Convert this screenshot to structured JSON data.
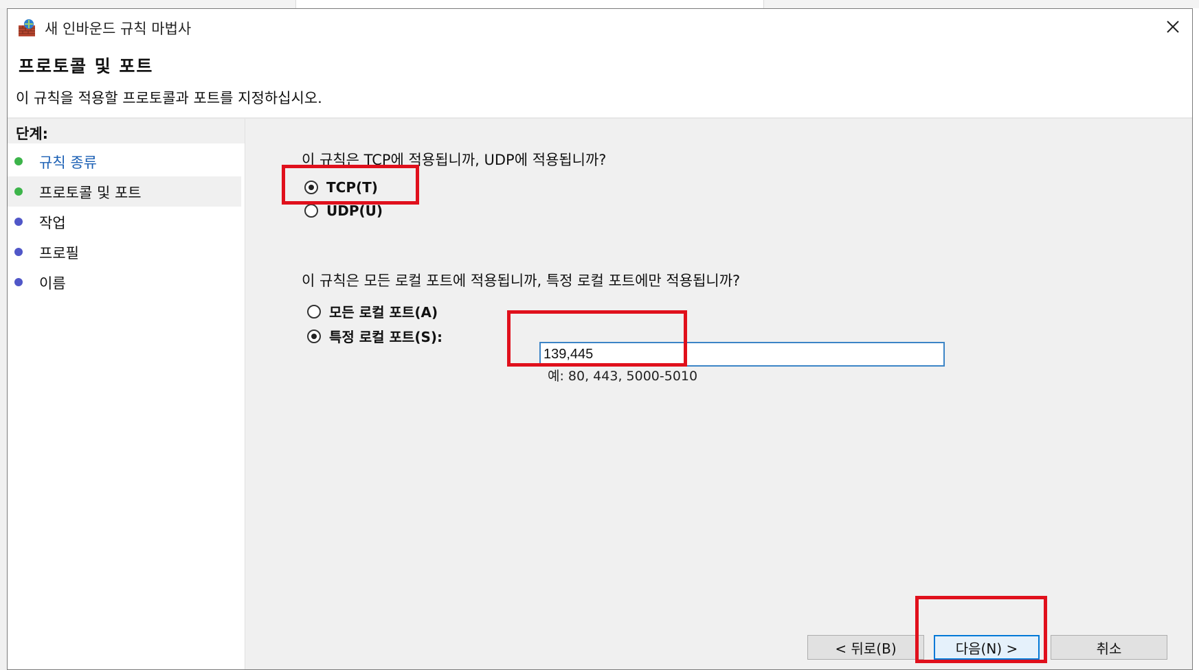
{
  "window": {
    "title": "새 인바운드 규칙 마법사",
    "close_symbol": "✕"
  },
  "header": {
    "title": "프로토콜 및 포트",
    "description": "이 규칙을 적용할 프로토콜과 포트를 지정하십시오."
  },
  "steps": {
    "heading": "단계:",
    "items": [
      {
        "label": "규칙 종류",
        "state": "link",
        "dot_color": "#3cb44a"
      },
      {
        "label": "프로토콜 및 포트",
        "state": "current",
        "dot_color": "#3cb44a"
      },
      {
        "label": "작업",
        "state": "pending",
        "dot_color": "#5057c8"
      },
      {
        "label": "프로필",
        "state": "pending",
        "dot_color": "#5057c8"
      },
      {
        "label": "이름",
        "state": "pending",
        "dot_color": "#5057c8"
      }
    ]
  },
  "protocol": {
    "question": "이 규칙은 TCP에 적용됩니까, UDP에 적용됩니까?",
    "options": [
      {
        "label": "TCP(T)",
        "checked": true
      },
      {
        "label": "UDP(U)",
        "checked": false
      }
    ]
  },
  "ports": {
    "question": "이 규칙은 모든 로컬 포트에 적용됩니까, 특정 로컬 포트에만 적용됩니까?",
    "options": [
      {
        "label": "모든 로컬 포트(A)",
        "checked": false
      },
      {
        "label": "특정 로컬 포트(S):",
        "checked": true
      }
    ],
    "specific_value": "139,445",
    "example": "예: 80, 443, 5000-5010"
  },
  "buttons": {
    "back": "< 뒤로(B)",
    "next": "다음(N) >",
    "cancel": "취소"
  },
  "colors": {
    "annotation_red": "#e0101c",
    "link_blue": "#1a5fb4",
    "focus_blue": "#0078d7"
  }
}
